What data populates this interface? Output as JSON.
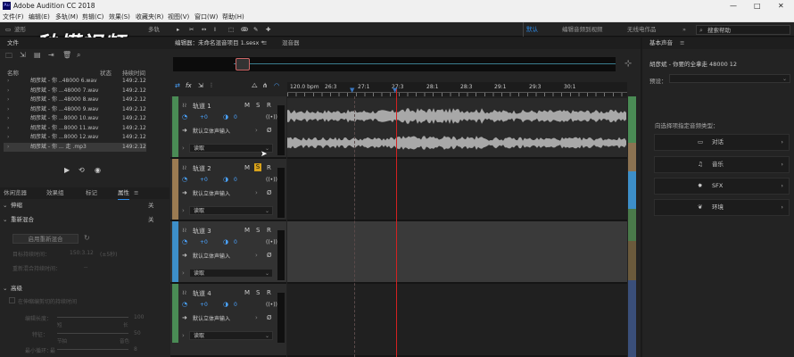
{
  "app_title": "Adobe Audition CC 2018",
  "window_controls": [
    "—",
    "□",
    "✕"
  ],
  "menu": [
    "文件(F)",
    "编辑(E)",
    "多轨(M)",
    "剪辑(C)",
    "效果(S)",
    "收藏夹(R)",
    "视图(V)",
    "窗口(W)",
    "帮助(H)"
  ],
  "toolbar": {
    "waveform_label": "波形",
    "multitrack_label": "多轨",
    "workspaces": [
      "默认",
      "编辑音频到视频",
      "无线电作品"
    ],
    "workspace_menu": "»",
    "search_placeholder": "搜索帮助"
  },
  "watermark": "秒懂视频",
  "files_panel": {
    "tab": "文件",
    "columns": {
      "name": "名称",
      "status": "状态",
      "duration": "持续时间"
    },
    "rows": [
      {
        "name": "胡彦斌 - 你 ..48000 6.wav",
        "duration": "149:2.12"
      },
      {
        "name": "胡彦斌 - 你 ...48000 7.wav",
        "duration": "149:2.12"
      },
      {
        "name": "胡彦斌 - 你 ...48000 8.wav",
        "duration": "149:2.12"
      },
      {
        "name": "胡彦斌 - 你 ...48000 9.wav",
        "duration": "149:2.12"
      },
      {
        "name": "胡彦斌 - 你 ...8000 10.wav",
        "duration": "149:2.12"
      },
      {
        "name": "胡彦斌 - 你 ...8000 11.wav",
        "duration": "149:2.12"
      },
      {
        "name": "胡彦斌 - 你 ...8000 12.wav",
        "duration": "149:2.12"
      },
      {
        "name": "胡彦斌 - 你 ... 走 .mp3",
        "duration": "149:2.12"
      }
    ]
  },
  "props_panel": {
    "tabs": [
      "休闲览器",
      "效果组",
      "标记",
      "属性"
    ],
    "close": "关",
    "sec1": "伸缩",
    "sec1_close": "关",
    "sec2": "重新混合",
    "sec2_close": "关",
    "enable_button": "启用重新混合",
    "target_label": "目标持续时间：",
    "target_value": "150:3.12",
    "target_unit": "(±5秒)",
    "remix_label": "重新混合持续时间：",
    "remix_value": "--",
    "adv": "高级",
    "checkbox_label": "在伸缩编剪切的持续时间",
    "s1": "编辑长度：",
    "s1_left": "短",
    "s1_right": "长",
    "s1_value": "100",
    "s2": "特征：",
    "s2_left": "节拍",
    "s2_right": "音色",
    "s2_value": "50",
    "s3": "最小循环：",
    "s3_left": "最",
    "s3_value": "8"
  },
  "editor": {
    "tab": "编辑器：未命名混音项目 1.sesx *",
    "mixer_tab": "混音器",
    "ruler": [
      "120.0 bpm",
      "26:3",
      "27:1",
      "27:3",
      "28:1",
      "28:3",
      "29:1",
      "29:3",
      "30:1"
    ],
    "tracks": [
      {
        "name": "轨道 1",
        "vol": "+0",
        "pan": "0",
        "io": "默认立体声输入",
        "mode": "读取",
        "color": "#4a8b55"
      },
      {
        "name": "轨道 2",
        "vol": "+0",
        "pan": "0",
        "io": "默认立体声输入",
        "mode": "读取",
        "color": "#9b7b52"
      },
      {
        "name": "轨道 3",
        "vol": "+0",
        "pan": "0",
        "io": "默认立体声输入",
        "mode": "读取",
        "color": "#3d8fc9"
      },
      {
        "name": "轨道 4",
        "vol": "+0",
        "pan": "0",
        "io": "默认立体声输入",
        "mode": "读取",
        "color": "#4a8b55"
      }
    ],
    "msr": [
      "M",
      "S",
      "R"
    ]
  },
  "essential_sound": {
    "tab": "基本声音",
    "file": "胡彦斌 - 你要的全拿走 48000 12",
    "preset_label": "预设：",
    "prompt": "向选择项指定音频类型：",
    "categories": [
      {
        "label": "对话",
        "icon": "speech-icon"
      },
      {
        "label": "音乐",
        "icon": "music-note-icon"
      },
      {
        "label": "SFX",
        "icon": "burst-icon"
      },
      {
        "label": "环境",
        "icon": "leaf-icon"
      }
    ]
  },
  "colors": {
    "accent": "#2d8ceb",
    "playhead": "#d42121",
    "waveform": "#aaaaaa"
  }
}
